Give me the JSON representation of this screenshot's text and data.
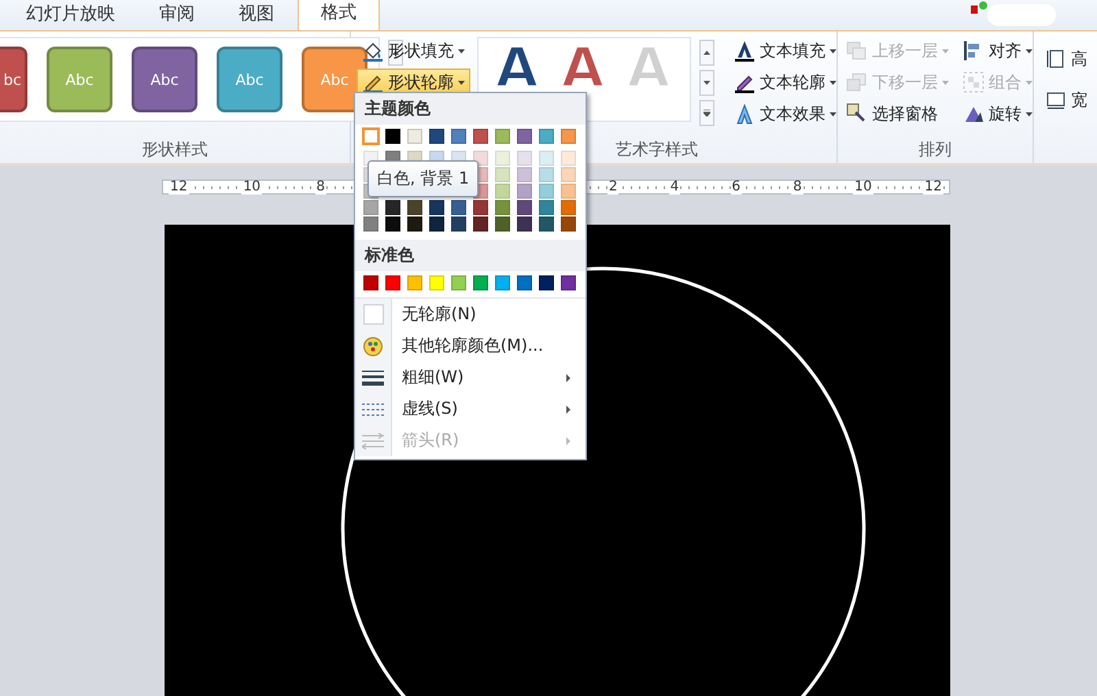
{
  "tabs": [
    {
      "label": "幻灯片放映",
      "selected": false
    },
    {
      "label": "审阅",
      "selected": false
    },
    {
      "label": "视图",
      "selected": false
    },
    {
      "label": "格式",
      "selected": true
    }
  ],
  "shape_styles": {
    "label": "形状样式",
    "swatches": [
      {
        "label": "bc",
        "color": "#c0504d"
      },
      {
        "label": "Abc",
        "color": "#9bbb59"
      },
      {
        "label": "Abc",
        "color": "#8064a2"
      },
      {
        "label": "Abc",
        "color": "#4bacc6"
      },
      {
        "label": "Abc",
        "color": "#f79646"
      }
    ],
    "commands": [
      {
        "label": "形状填充",
        "kind": "fill",
        "open": false
      },
      {
        "label": "形状轮廓",
        "kind": "outline",
        "open": true
      }
    ]
  },
  "wordart_styles": {
    "label": "艺术字样式",
    "presets": [
      {
        "label": "A",
        "color": "#1f497d"
      },
      {
        "label": "A",
        "color": "#c0504d"
      },
      {
        "label": "A",
        "color": "#d0d0d0"
      }
    ],
    "commands": [
      {
        "label": "文本填充",
        "kind": "fill"
      },
      {
        "label": "文本轮廓",
        "kind": "outline"
      },
      {
        "label": "文本效果",
        "kind": "effects"
      }
    ]
  },
  "arrange": {
    "label": "排列",
    "commands": [
      {
        "label": "上移一层",
        "kind": "forward",
        "disabled": true,
        "dropdown": true
      },
      {
        "label": "下移一层",
        "kind": "backward",
        "disabled": true,
        "dropdown": true
      },
      {
        "label": "选择窗格",
        "kind": "pane",
        "disabled": false,
        "dropdown": false
      },
      {
        "label": "对齐",
        "kind": "align",
        "disabled": false,
        "dropdown": true
      },
      {
        "label": "组合",
        "kind": "group",
        "disabled": true,
        "dropdown": true
      },
      {
        "label": "旋转",
        "kind": "rotate",
        "disabled": false,
        "dropdown": true
      }
    ]
  },
  "size": {
    "commands": [
      {
        "label": "高",
        "kind": "height"
      },
      {
        "label": "宽",
        "kind": "width"
      }
    ]
  },
  "ruler": {
    "left_labels": [
      "12",
      "10",
      "8"
    ],
    "right_labels": [
      "2",
      "4",
      "6",
      "8",
      "10",
      "12"
    ]
  },
  "outline_menu": {
    "theme_heading": "主题颜色",
    "theme_colors": [
      {
        "color": "#ffffff",
        "selected": true,
        "shades": [
          {
            "color": "#f2f2f2"
          },
          {
            "color": "#d9d9d9"
          },
          {
            "color": "#bfbfbf"
          },
          {
            "color": "#a6a6a6"
          },
          {
            "color": "#808080"
          }
        ]
      },
      {
        "color": "#000000",
        "selected": false,
        "shades": [
          {
            "color": "#7f7f7f"
          },
          {
            "color": "#262626"
          },
          {
            "color": "#0d0d0d"
          }
        ]
      },
      {
        "color": "#eeece1",
        "selected": false,
        "shades": [
          {
            "color": "#ddd9c3"
          },
          {
            "color": "#494429"
          },
          {
            "color": "#1d1b10"
          }
        ]
      },
      {
        "color": "#1f497d",
        "selected": false,
        "shades": [
          {
            "color": "#c6d9f0"
          },
          {
            "color": "#17365d"
          },
          {
            "color": "#0f243e"
          }
        ]
      },
      {
        "color": "#4f81bd",
        "selected": false,
        "shades": [
          {
            "color": "#dbe5f1"
          },
          {
            "color": "#366092"
          },
          {
            "color": "#244061"
          }
        ]
      },
      {
        "color": "#c0504d",
        "selected": false,
        "shades": [
          {
            "color": "#f2dcdb"
          },
          {
            "color": "#e5b9b7"
          },
          {
            "color": "#d99694"
          },
          {
            "color": "#953734"
          },
          {
            "color": "#632423"
          }
        ]
      },
      {
        "color": "#9bbb59",
        "selected": false,
        "shades": [
          {
            "color": "#ebf1dd"
          },
          {
            "color": "#d7e3bc"
          },
          {
            "color": "#c3d69b"
          },
          {
            "color": "#76923c"
          },
          {
            "color": "#4f6128"
          }
        ]
      },
      {
        "color": "#8064a2",
        "selected": false,
        "shades": [
          {
            "color": "#e5e0ec"
          },
          {
            "color": "#ccc1d9"
          },
          {
            "color": "#b2a2c7"
          },
          {
            "color": "#5f497a"
          },
          {
            "color": "#3f3151"
          }
        ]
      },
      {
        "color": "#4bacc6",
        "selected": false,
        "shades": [
          {
            "color": "#dbeef3"
          },
          {
            "color": "#b7dde8"
          },
          {
            "color": "#92cddc"
          },
          {
            "color": "#31859b"
          },
          {
            "color": "#205867"
          }
        ]
      },
      {
        "color": "#f79646",
        "selected": false,
        "shades": [
          {
            "color": "#fdeada"
          },
          {
            "color": "#fbd5b5"
          },
          {
            "color": "#fac08f"
          },
          {
            "color": "#e36c09"
          },
          {
            "color": "#974806"
          }
        ]
      }
    ],
    "standard_heading": "标准色",
    "standard_colors": [
      {
        "color": "#c00000",
        "selected": false
      },
      {
        "color": "#ff0000",
        "selected": false
      },
      {
        "color": "#ffc000",
        "selected": false
      },
      {
        "color": "#ffff00",
        "selected": false
      },
      {
        "color": "#92d050",
        "selected": false
      },
      {
        "color": "#00b050",
        "selected": false
      },
      {
        "color": "#00b0f0",
        "selected": false
      },
      {
        "color": "#0070c0",
        "selected": false
      },
      {
        "color": "#002060",
        "selected": false
      },
      {
        "color": "#7030a0",
        "selected": false
      }
    ],
    "items": [
      {
        "label": "无轮廓(N)",
        "kind": "none",
        "disabled": false,
        "submenu": false
      },
      {
        "label": "其他轮廓颜色(M)...",
        "kind": "more",
        "disabled": false,
        "submenu": false
      },
      {
        "label": "粗细(W)",
        "kind": "weight",
        "disabled": false,
        "submenu": true
      },
      {
        "label": "虚线(S)",
        "kind": "dash",
        "disabled": false,
        "submenu": true
      },
      {
        "label": "箭头(R)",
        "kind": "arrows",
        "disabled": true,
        "submenu": true
      }
    ],
    "tooltip": "白色, 背景 1"
  }
}
